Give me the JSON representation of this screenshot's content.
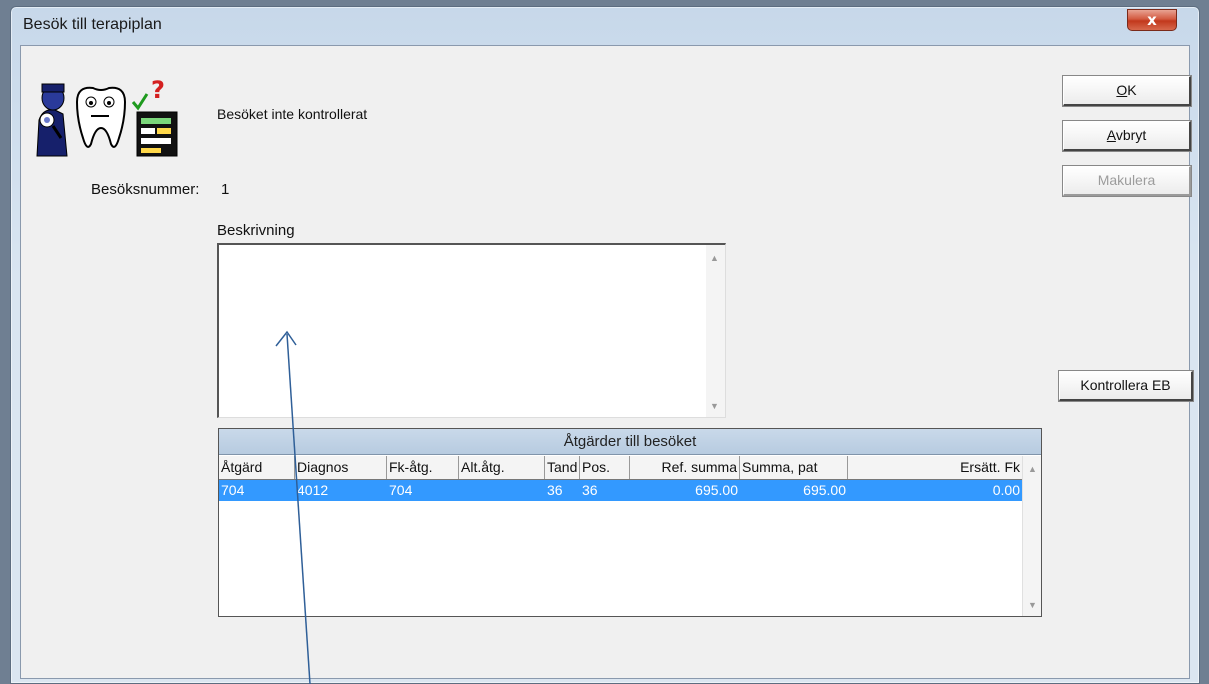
{
  "window": {
    "title": "Besök till terapiplan",
    "close_glyph": "x"
  },
  "status": {
    "text": "Besöket inte kontrollerat"
  },
  "visit": {
    "label": "Besöksnummer:",
    "value": "1"
  },
  "description": {
    "label": "Beskrivning",
    "value": ""
  },
  "buttons": {
    "ok": {
      "underline": "O",
      "rest": "K"
    },
    "avbryt": {
      "underline": "A",
      "rest": "vbryt"
    },
    "makulera": "Makulera",
    "kontrollera": "Kontrollera EB"
  },
  "grid": {
    "title": "Åtgärder till besöket",
    "columns": [
      "Åtgärd",
      "Diagnos",
      "Fk-åtg.",
      "Alt.åtg.",
      "Tand",
      "Pos.",
      "Ref. summa",
      "Summa, pat",
      "Ersätt. Fk"
    ],
    "rows": [
      [
        "704",
        "4012",
        "704",
        "",
        "36",
        "36",
        "695.00",
        "695.00",
        "0.00"
      ]
    ]
  },
  "icons": [
    "doctor-icon",
    "tooth-icon",
    "checklist-icon"
  ],
  "colors": {
    "selection": "#3399ff",
    "close": "#c2381c",
    "annotation": "#2f5f98"
  }
}
